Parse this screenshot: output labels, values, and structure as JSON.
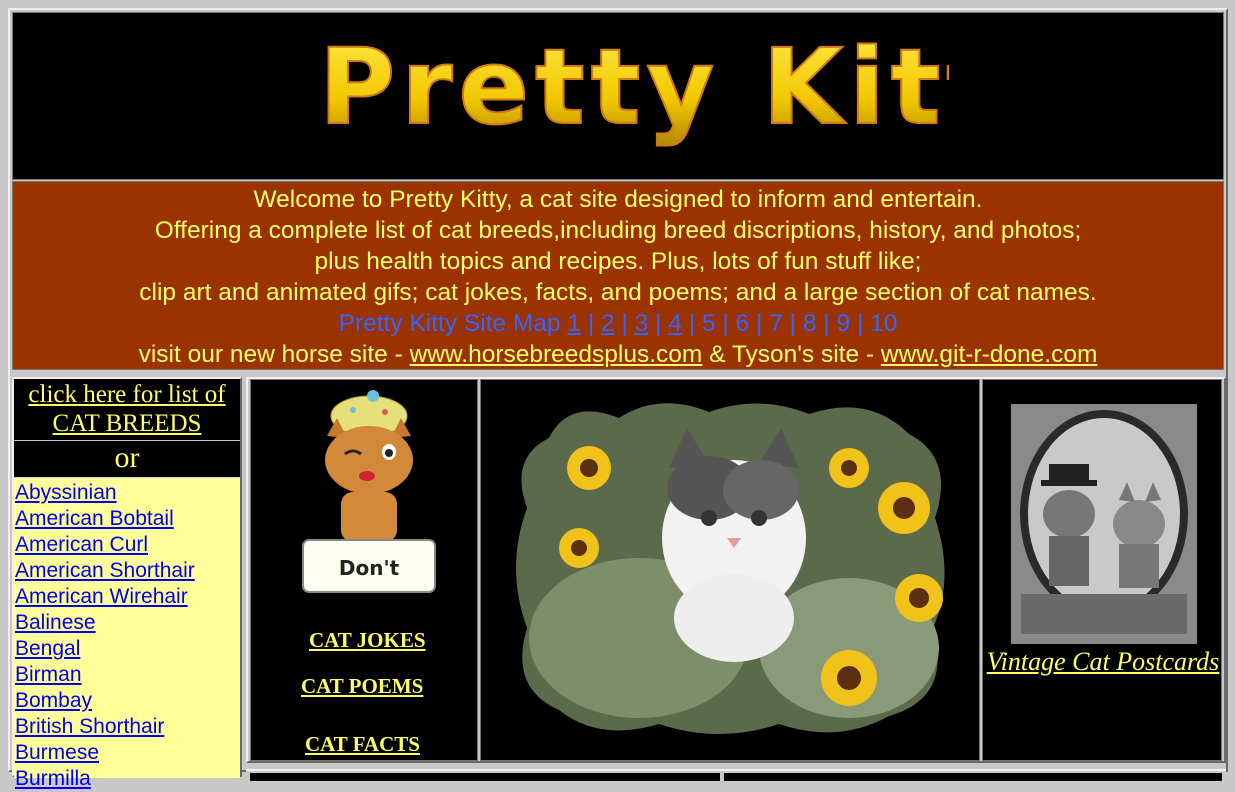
{
  "header": {
    "logo_text": "Pretty Kitty"
  },
  "welcome": {
    "line1": "Welcome to Pretty Kitty, a cat site designed to inform and entertain.",
    "line2": "Offering a complete list of cat breeds,including breed discriptions, history, and photos;",
    "line3": "plus health topics and recipes. Plus, lots of fun stuff like;",
    "line4": "clip art and animated gifs; cat jokes, facts, and poems; and a large section of cat names.",
    "sitemap_label": "Pretty Kitty Site Map",
    "sitemap_pages": [
      "1",
      "2",
      "3",
      "4",
      "5",
      "6",
      "7",
      "8",
      "9",
      "10"
    ],
    "sitemap_sep": "|",
    "visit_prefix": "visit our new horse site -",
    "horse_link": "www.horsebreedsplus.com",
    "tyson_text": "& Tyson's site -",
    "tyson_link": "www.git-r-done.com"
  },
  "sidebar": {
    "breeds_link": "click here for list of CAT BREEDS",
    "or_text": "or",
    "breeds": [
      "Abyssinian",
      "American Bobtail",
      "American Curl",
      "American Shorthair",
      "American Wirehair",
      "Balinese",
      "Bengal",
      "Birman",
      "Bombay",
      "British Shorthair",
      "Burmese",
      "Burmilla"
    ]
  },
  "main": {
    "dont_sign": "Don't",
    "jokes_link": "CAT JOKES",
    "poems_link": "CAT POEMS",
    "facts_link": "CAT FACTS",
    "vintage_link": "Vintage Cat Postcards"
  },
  "colors": {
    "accent_yellow": "#ffff66",
    "banner_brown": "#9a3300",
    "link_blue": "#0000ee",
    "breed_bg": "#ffff99"
  }
}
